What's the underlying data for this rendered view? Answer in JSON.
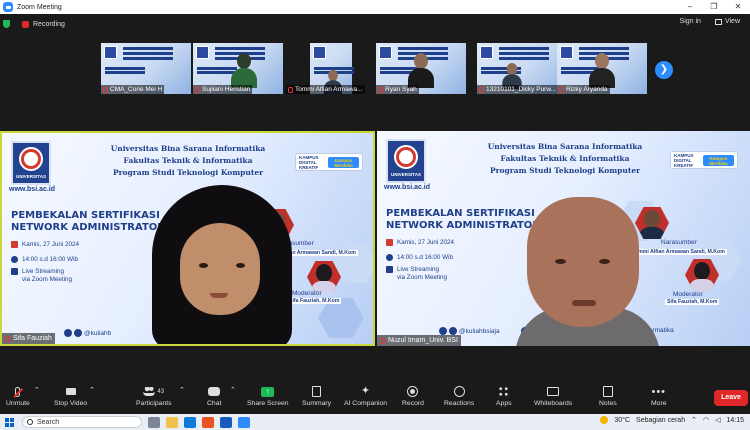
{
  "window": {
    "title": "Zoom Meeting",
    "controls": [
      "–",
      "❐",
      "✕"
    ]
  },
  "topbar": {
    "recording_label": "Recording",
    "sign_in": "Sign in",
    "view": "View"
  },
  "thumbnails": [
    {
      "name": "CMA_Corie Mei H",
      "type": "slide"
    },
    {
      "name": "Sujiiani Heristian",
      "type": "person"
    },
    {
      "name": "Tommi Alfian Armawa...",
      "type": "person"
    },
    {
      "name": "Ryan Syah",
      "type": "person"
    },
    {
      "name": "13210101_Dicky Purw...",
      "type": "person"
    },
    {
      "name": "Rizky Aryanda",
      "type": "person"
    }
  ],
  "slide": {
    "uni_lines": [
      "Universitas Bina Sarana Informatika",
      "Fakultas Teknik & Informatika",
      "Program Studi Teknologi Komputer"
    ],
    "logo_label": "UNIVERSITAS",
    "website": "www.bsi.ac.id",
    "kampus_label": "KAMPUS DIGITAL KREATIF",
    "merdeka_label": "Kampus Merdeka",
    "headline_1": "PEMBEKALAN SERTIFIKASI",
    "headline_2_left": "NETWORK ADMINISTRATOR M",
    "headline_2_right": "NETWORK ADMINISTRATOR M",
    "date": "Kamis, 27 Juni 2024",
    "time": "14:00 s.d 16:00 Wib",
    "stream_1": "Live Streaming",
    "stream_2": "via Zoom Meeting",
    "narasumber": "Narasumber",
    "narasumber_name": "Tommi Alfian Armawan Sandi, M.Kom",
    "narasumber_name_short": "ommi Alfian Armawan Sandi, M.Kom",
    "moderator": "Moderator",
    "moderator_name": "Sifa Fauziah, M.Kom",
    "social_left": "@kuliahb",
    "social_right": "@kuliahbsiaja",
    "social_tail": "formatika"
  },
  "videos": [
    {
      "name": "Sifa Fauziah"
    },
    {
      "name": "Nuzul Imam_Univ. BSI"
    }
  ],
  "toolbar": {
    "unmute": "Unmute",
    "stop_video": "Stop Video",
    "participants": "Participants",
    "participants_count": "43",
    "chat": "Chat",
    "share_screen": "Share Screen",
    "summary": "Summary",
    "ai_companion": "AI Companion",
    "record": "Record",
    "reactions": "Reactions",
    "apps": "Apps",
    "whiteboards": "Whiteboards",
    "notes": "Notes",
    "more": "More",
    "leave": "Leave"
  },
  "taskbar": {
    "search": "Search",
    "weather": "30°C",
    "weather_desc": "Sebagian cerah",
    "time": "14:15"
  },
  "colors": {
    "zoom_blue": "#2d8cff",
    "leave_red": "#e02828",
    "share_green": "#1db954",
    "active_speaker": "#c9d93b",
    "slide_navy": "#1f3f8a"
  }
}
